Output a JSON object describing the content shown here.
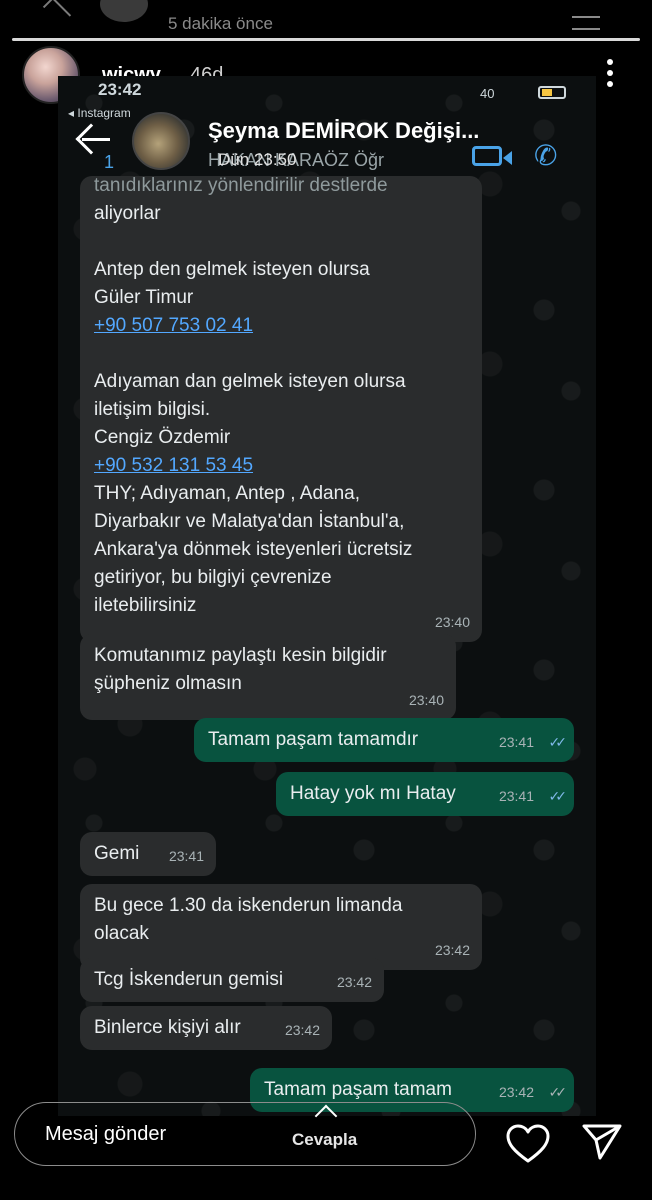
{
  "top_remnant": {
    "text": "5 dakika önce"
  },
  "story": {
    "username": "wicwy",
    "time": "46d"
  },
  "screenshot": {
    "status_time": "23:42",
    "status_signal": "40",
    "back_label": "◂ Instagram",
    "chat": {
      "unread_count": "1",
      "title": "Şeyma DEMİROK Değişi...",
      "subtitle": "HAKAN KARAÖZ Öğr",
      "last_seen": "Dün 23:50"
    },
    "messages": [
      {
        "direction": "in",
        "lines": [
          "tanıdıklarınız yönlendirilir destlerde",
          "aliyorlar",
          "",
          "Antep den gelmek isteyen olursa",
          "Güler Timur"
        ],
        "link1": "+90 507 753 02 41",
        "lines2": [
          "",
          "Adıyaman dan gelmek isteyen olursa",
          "iletişim bilgisi.",
          "Cengiz Özdemir"
        ],
        "link2": "+90 532 131 53 45",
        "lines3": [
          "THY; Adıyaman, Antep , Adana,",
          "Diyarbakır ve Malatya'dan İstanbul'a,",
          "Ankara'ya dönmek isteyenleri ücretsiz",
          "getiriyor,  bu bilgiyi çevrenize",
          "iletebilirsiniz"
        ],
        "time": "23:40"
      },
      {
        "direction": "in",
        "lines": [
          "Komutanımız paylaştı kesin bilgidir",
          "şüpheniz olmasın"
        ],
        "time": "23:40"
      },
      {
        "direction": "out",
        "lines": [
          "Tamam paşam  tamamdır"
        ],
        "time": "23:41"
      },
      {
        "direction": "out",
        "lines": [
          "Hatay yok mı Hatay"
        ],
        "time": "23:41"
      },
      {
        "direction": "in",
        "lines": [
          "Gemi"
        ],
        "time": "23:41"
      },
      {
        "direction": "in",
        "lines": [
          "Bu gece 1.30 da iskenderun limanda",
          "olacak"
        ],
        "time": "23:42"
      },
      {
        "direction": "in",
        "lines": [
          "Tcg İskenderun gemisi"
        ],
        "time": "23:42"
      },
      {
        "direction": "in",
        "lines": [
          "Binlerce kişiyi alır"
        ],
        "time": "23:42"
      },
      {
        "direction": "out",
        "lines": [
          "Tamam paşam tamam"
        ],
        "time": "23:42"
      }
    ]
  },
  "controls": {
    "message_placeholder": "Mesaj gönder",
    "reply_label": "Cevapla"
  },
  "icons": {
    "heart": "heart-icon",
    "send": "send-icon",
    "more": "more-icon",
    "video": "video-call-icon",
    "phone": "phone-call-icon"
  },
  "colors": {
    "incoming_bubble": "#2a2c2d",
    "outgoing_bubble": "#08533f",
    "link": "#53a8ff",
    "accent": "#4aa3e8"
  }
}
